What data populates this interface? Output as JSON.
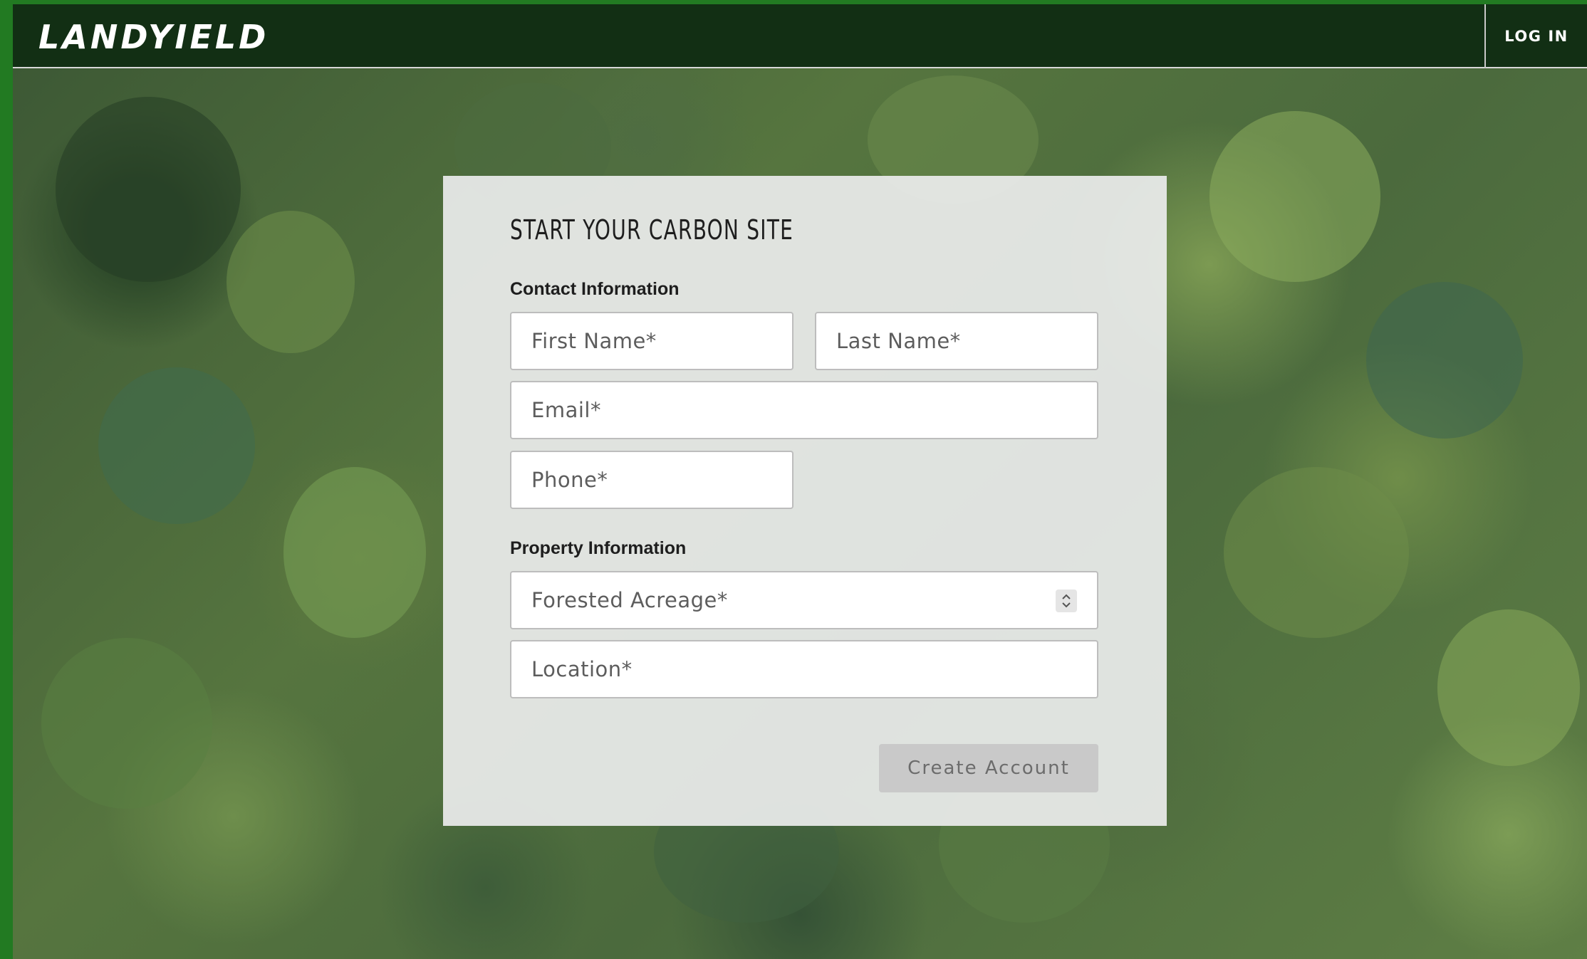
{
  "header": {
    "logo_text": "LANDYIELD",
    "login_label": "LOG IN"
  },
  "form": {
    "title": "START YOUR CARBON SITE",
    "contact_section": "Contact Information",
    "first_name_placeholder": "First Name*",
    "last_name_placeholder": "Last Name*",
    "email_placeholder": "Email*",
    "phone_placeholder": "Phone*",
    "property_section": "Property Information",
    "acreage_placeholder": "Forested Acreage*",
    "location_placeholder": "Location*",
    "submit_label": "Create Account"
  },
  "colors": {
    "header_bg": "#122f14",
    "accent_green": "#227a22",
    "button_disabled": "#c9c9c9"
  },
  "icons": {
    "spinner": "up-down-chevron-icon"
  }
}
